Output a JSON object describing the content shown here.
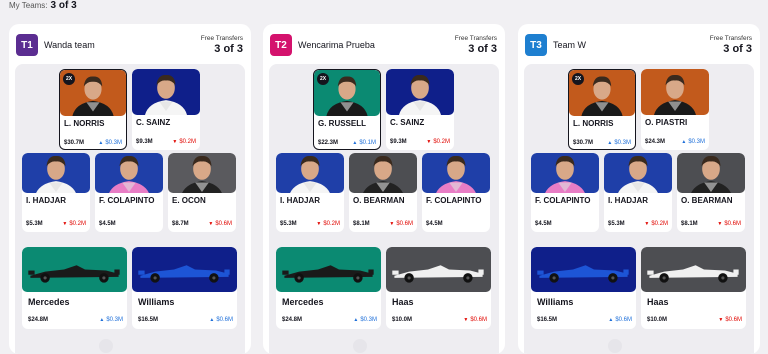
{
  "header": {
    "my_teams_label": "My Teams:",
    "my_teams_value": "3 of 3"
  },
  "colors": {
    "papaya": "#c25a1c",
    "ferrari_red": "#c8102e",
    "williams_blue": "#0f1f8a",
    "alpine_pink": "#1f3fa8",
    "mercedes_teal": "#0b8a72",
    "haas_grey": "#4d4e52",
    "racing_bulls": "#5a5a5e",
    "delta_up": "#1e6fd9",
    "delta_down": "#e10600"
  },
  "panels": [
    {
      "badge": "T1",
      "badge_color": "#5b2d91",
      "name": "Wanda team",
      "ft_label": "Free Transfers",
      "ft_value": "3 of 3",
      "drivers_top": [
        {
          "name": "L. NORRIS",
          "price": "$30.7M",
          "delta": "$0.3M",
          "dir": "up",
          "bg": "#c25a1c",
          "suit": "#1a1a1a",
          "twox": "2X",
          "selected": true
        },
        {
          "name": "C. SAINZ",
          "price": "$9.3M",
          "delta": "$0.2M",
          "dir": "down",
          "bg": "#0f1f8a",
          "suit": "#f5f5f5"
        }
      ],
      "drivers_mid": [
        {
          "name": "I. HADJAR",
          "price": "$5.3M",
          "delta": "$0.2M",
          "dir": "down",
          "bg": "#1f3fa8",
          "suit": "#f5f5f5"
        },
        {
          "name": "F. COLAPINTO",
          "price": "$4.5M",
          "delta": "",
          "dir": "",
          "bg": "#1f3fa8",
          "suit": "#e87dc5"
        },
        {
          "name": "E. OCON",
          "price": "$8.7M",
          "delta": "$0.6M",
          "dir": "down",
          "bg": "#5a5a5e",
          "suit": "#222"
        }
      ],
      "constructors": [
        {
          "name": "Mercedes",
          "price": "$24.8M",
          "delta": "$0.3M",
          "dir": "up",
          "bg": "#0b8a72",
          "car": "#1a1a1a"
        },
        {
          "name": "Williams",
          "price": "$16.5M",
          "delta": "$0.6M",
          "dir": "up",
          "bg": "#0f1f8a",
          "car": "#1d55d6"
        }
      ]
    },
    {
      "badge": "T2",
      "badge_color": "#d4126d",
      "name": "Wencarima Prueba",
      "ft_label": "Free Transfers",
      "ft_value": "3 of 3",
      "drivers_top": [
        {
          "name": "G. RUSSELL",
          "price": "$22.3M",
          "delta": "$0.1M",
          "dir": "up",
          "bg": "#0b8a72",
          "suit": "#1a1a1a",
          "twox": "2X",
          "selected": true
        },
        {
          "name": "C. SAINZ",
          "price": "$9.3M",
          "delta": "$0.2M",
          "dir": "down",
          "bg": "#0f1f8a",
          "suit": "#f5f5f5"
        }
      ],
      "drivers_mid": [
        {
          "name": "I. HADJAR",
          "price": "$5.3M",
          "delta": "$0.2M",
          "dir": "down",
          "bg": "#1f3fa8",
          "suit": "#f5f5f5"
        },
        {
          "name": "O. BEARMAN",
          "price": "$8.1M",
          "delta": "$0.6M",
          "dir": "down",
          "bg": "#4d4e52",
          "suit": "#222"
        },
        {
          "name": "F. COLAPINTO",
          "price": "$4.5M",
          "delta": "",
          "dir": "",
          "bg": "#1f3fa8",
          "suit": "#e87dc5"
        }
      ],
      "constructors": [
        {
          "name": "Mercedes",
          "price": "$24.8M",
          "delta": "$0.3M",
          "dir": "up",
          "bg": "#0b8a72",
          "car": "#1a1a1a"
        },
        {
          "name": "Haas",
          "price": "$10.0M",
          "delta": "$0.6M",
          "dir": "down",
          "bg": "#4d4e52",
          "car": "#f0f0f0"
        }
      ]
    },
    {
      "badge": "T3",
      "badge_color": "#1e7fd0",
      "name": "Team W",
      "ft_label": "Free Transfers",
      "ft_value": "3 of 3",
      "drivers_top": [
        {
          "name": "L. NORRIS",
          "price": "$30.7M",
          "delta": "$0.3M",
          "dir": "up",
          "bg": "#c25a1c",
          "suit": "#1a1a1a",
          "twox": "2X",
          "selected": true
        },
        {
          "name": "O. PIASTRI",
          "price": "$24.3M",
          "delta": "$0.3M",
          "dir": "up",
          "bg": "#c25a1c",
          "suit": "#1a1a1a"
        }
      ],
      "drivers_mid": [
        {
          "name": "F. COLAPINTO",
          "price": "$4.5M",
          "delta": "",
          "dir": "",
          "bg": "#1f3fa8",
          "suit": "#e87dc5"
        },
        {
          "name": "I. HADJAR",
          "price": "$5.3M",
          "delta": "$0.2M",
          "dir": "down",
          "bg": "#1f3fa8",
          "suit": "#f5f5f5"
        },
        {
          "name": "O. BEARMAN",
          "price": "$8.1M",
          "delta": "$0.6M",
          "dir": "down",
          "bg": "#4d4e52",
          "suit": "#222"
        }
      ],
      "constructors": [
        {
          "name": "Williams",
          "price": "$16.5M",
          "delta": "$0.6M",
          "dir": "up",
          "bg": "#0f1f8a",
          "car": "#1d55d6"
        },
        {
          "name": "Haas",
          "price": "$10.0M",
          "delta": "$0.6M",
          "dir": "down",
          "bg": "#4d4e52",
          "car": "#f0f0f0"
        }
      ]
    }
  ]
}
